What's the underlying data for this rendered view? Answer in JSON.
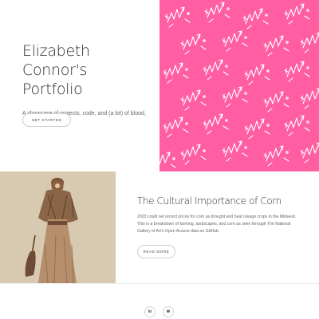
{
  "hero": {
    "title": "Elizabeth Connor's Portfolio",
    "subtitle": "A showcase of projects, code, and (a lot) of blood, sweat, and tears...",
    "cta_label": "GET STARTED",
    "pattern_color": "#ff5fa2"
  },
  "article": {
    "title": "The Cultural Importance of Corn",
    "body": "2023 could set record prices for corn as drought and heat ravage crops in the Midwest. This is a breakdown of farming, landscapes, and corn as seen through The National Gallery of Art's Open Access data on GitHub.",
    "button_label": "READ MORE",
    "image_desc_icon": "costume-figure-illustration"
  },
  "footer": {
    "icons": [
      {
        "name": "linkedin-icon",
        "glyph": "in"
      },
      {
        "name": "email-icon",
        "glyph": "✉"
      }
    ]
  },
  "colors": {
    "accent_pink": "#ff5fa2",
    "text_dark": "#2b2b2b",
    "text_muted": "#666666"
  }
}
